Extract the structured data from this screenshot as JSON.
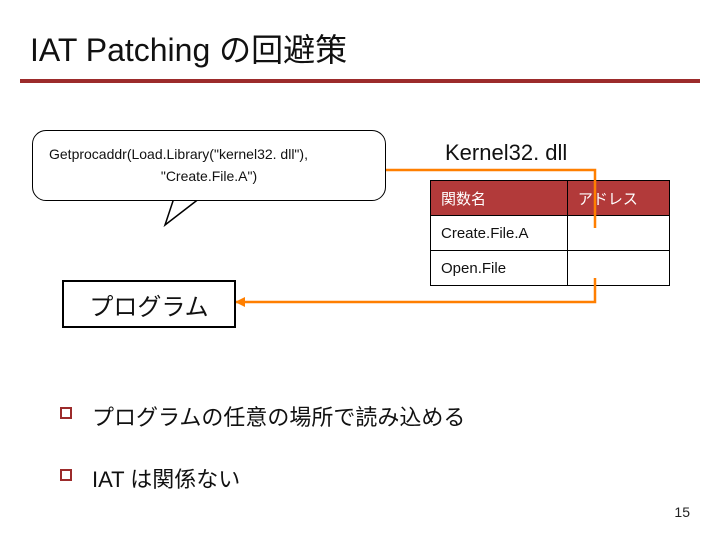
{
  "title": "IAT Patching の回避策",
  "callout": {
    "line1": "Getprocaddr(Load.Library(\"kernel32. dll\"),",
    "line2": "\"Create.File.A\")"
  },
  "program_label": "プログラム",
  "dll": {
    "title": "Kernel32. dll",
    "headers": {
      "func": "関数名",
      "addr": "アドレス"
    },
    "rows": [
      {
        "func": "Create.File.A",
        "addr": ""
      },
      {
        "func": "Open.File",
        "addr": ""
      }
    ]
  },
  "bullets": [
    "プログラムの任意の場所で読み込める",
    "IAT は関係ない"
  ],
  "page_number": "15"
}
